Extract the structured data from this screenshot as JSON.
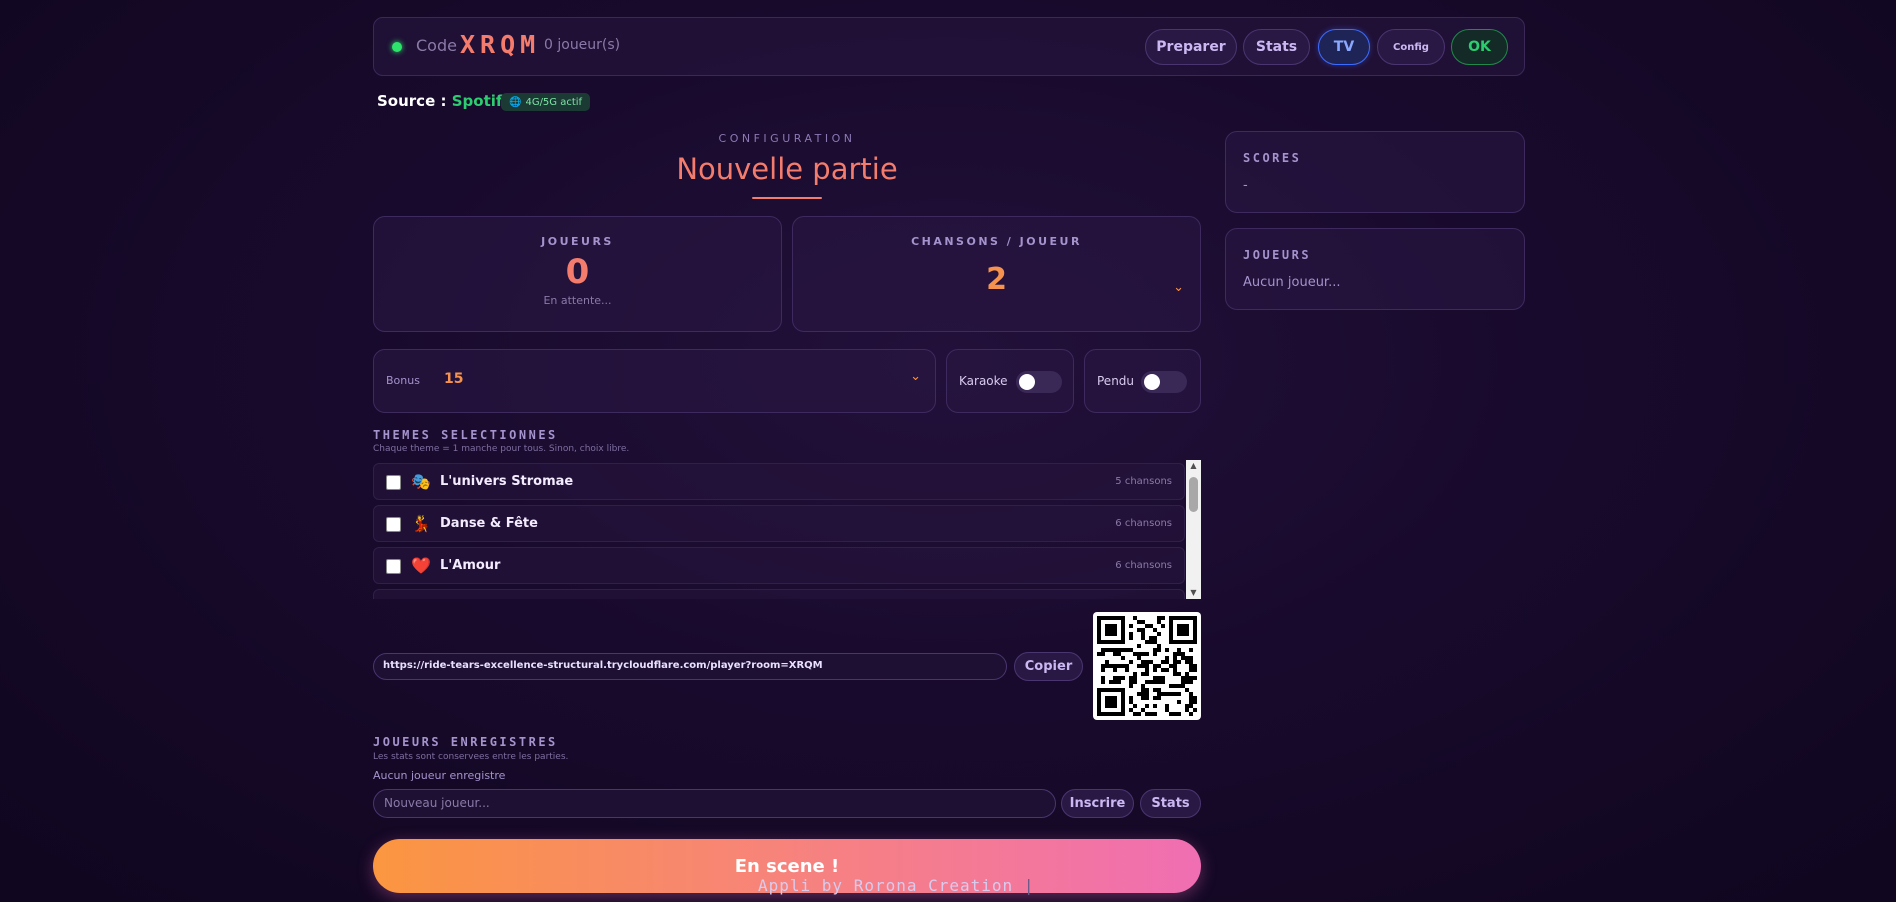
{
  "header": {
    "code_label": "Code",
    "room_code": "XRQM",
    "players_count": "0 joueur(s)",
    "buttons": {
      "preparer": "Preparer",
      "stats": "Stats",
      "tv": "TV",
      "config": "Config",
      "ok": "OK"
    }
  },
  "source": {
    "label": "Source :",
    "value": "Spotify",
    "network_badge": "4G/5G actif"
  },
  "config": {
    "kicker": "CONFIGURATION",
    "title": "Nouvelle partie"
  },
  "players_card": {
    "label": "JOUEURS",
    "value": "0",
    "status": "En attente..."
  },
  "songs_card": {
    "label": "CHANSONS / JOUEUR",
    "value": "2"
  },
  "bonus": {
    "label": "Bonus",
    "value": "15"
  },
  "toggles": {
    "karaoke": {
      "label": "Karaoke",
      "on": false
    },
    "pendu": {
      "label": "Pendu",
      "on": false
    }
  },
  "themes": {
    "title": "THEMES SELECTIONNES",
    "subtitle": "Chaque theme = 1 manche pour tous. Sinon, choix libre.",
    "items": [
      {
        "emoji": "🎭",
        "name": "L'univers Stromae",
        "count": "5 chansons"
      },
      {
        "emoji": "💃",
        "name": "Danse & Fête",
        "count": "6 chansons"
      },
      {
        "emoji": "❤️",
        "name": "L'Amour",
        "count": "6 chansons"
      }
    ]
  },
  "share": {
    "url": "https://ride-tears-excellence-structural.trycloudflare.com/player?room=XRQM",
    "copy_label": "Copier"
  },
  "registered": {
    "title": "JOUEURS ENREGISTRES",
    "subtitle": "Les stats sont conservees entre les parties.",
    "empty": "Aucun joueur enregistre",
    "input_placeholder": "Nouveau joueur...",
    "inscrire_label": "Inscrire",
    "stats_label": "Stats"
  },
  "cta": {
    "label": "En scene !"
  },
  "footer": {
    "text": "Appli by Rorona Creation",
    "separator": "|"
  },
  "sidebar": {
    "scores": {
      "title": "SCORES",
      "value": "-"
    },
    "joueurs": {
      "title": "JOUEURS",
      "value": "Aucun joueur..."
    }
  },
  "colors": {
    "accent_coral": "#f47c6c",
    "accent_orange": "#f5934e",
    "spotify_green": "#2ecc71",
    "tv_blue": "#3d6bff"
  }
}
